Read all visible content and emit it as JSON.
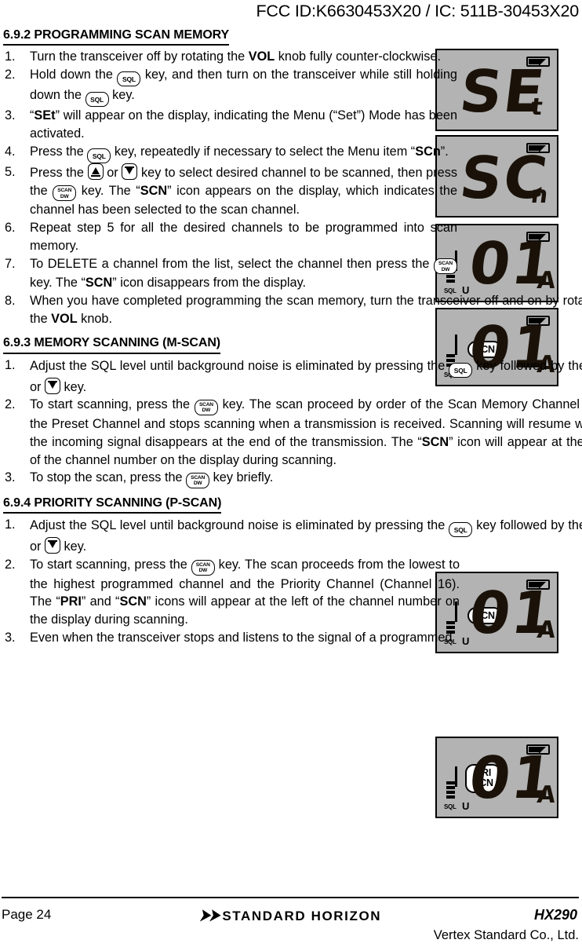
{
  "header": {
    "fcc_line": "FCC ID:K6630453X20 / IC: 511B-30453X20"
  },
  "sections": [
    {
      "id": "6.9.2",
      "number": "6.9.2",
      "title": "PROGRAMMING SCAN MEMORY",
      "heading_full": "6.9.2 PROGRAMMING SCAN MEMORY",
      "steps": [
        {
          "num": "1.",
          "text_parts": [
            "Turn the transceiver off by rotating the ",
            "VOL",
            " knob fully counter-clockwise."
          ]
        },
        {
          "num": "2.",
          "text_parts": [
            "Hold down the ",
            "SQL-KEY",
            " key, and then turn on the transceiver while still holding down the ",
            "SQL-KEY",
            " key."
          ]
        },
        {
          "num": "3.",
          "text_parts": [
            "“",
            "SEt",
            "” will appear on the display, indicating the Menu (“Set”) Mode has been activated."
          ]
        },
        {
          "num": "4.",
          "text_parts": [
            "Press the ",
            "SQL-KEY",
            " key, repeatedly if necessary to select the Menu item “",
            "SCn",
            "”."
          ]
        },
        {
          "num": "5.",
          "text_parts": [
            "Press the ",
            "UP-KEY",
            " or ",
            "DOWN-KEY",
            " key to select desired channel to be scanned, then press the ",
            "SCAN-KEY",
            " key. The “",
            "SCN",
            "” icon appears on the display, which indicates the channel has been selected to the scan channel."
          ]
        },
        {
          "num": "6.",
          "text_parts": [
            "Repeat step 5 for all the desired channels to be programmed into scan memory."
          ]
        },
        {
          "num": "7.",
          "text_parts": [
            "To DELETE a channel from the list, select the channel then press the ",
            "SCAN-KEY",
            " key. The “",
            "SCN",
            "” icon disappears from the display."
          ]
        },
        {
          "num": "8.",
          "text_parts": [
            "When you have completed programming the scan memory, turn the transceiver off and on by rotating the ",
            "VOL",
            " knob."
          ]
        }
      ]
    },
    {
      "id": "6.9.3",
      "number": "6.9.3",
      "title": "MEMORY SCANNING",
      "title_suffix": "(M-SCAN)",
      "heading_full": "6.9.3 MEMORY SCANNING (M-SCAN)",
      "steps": [
        {
          "num": "1.",
          "text_parts": [
            "Adjust the SQL level until background noise is eliminated by pressing the ",
            "SQL-KEY",
            " key followed by the ",
            "UP-KEY",
            " or ",
            "DOWN-KEY",
            " key."
          ]
        },
        {
          "num": "2.",
          "text_parts": [
            "To start scanning, press the ",
            "SCAN-KEY",
            " key. The scan proceed by order of the Scan Memory Channel and the Preset Channel and stops scanning when a transmission is received. Scanning will resume when the incoming signal disappears at the end of the transmission. The “",
            "SCN",
            "” icon will appear at the left of the channel number on the display during scanning."
          ]
        },
        {
          "num": "3.",
          "text_parts": [
            "To stop the scan, press the ",
            "SCAN-KEY",
            " key briefly."
          ]
        }
      ]
    },
    {
      "id": "6.9.4",
      "number": "6.9.4",
      "title": "PRIORITY SCANNING",
      "title_suffix": "(P-SCAN)",
      "heading_full": "6.9.4 PRIORITY SCANNING (P-SCAN)",
      "steps": [
        {
          "num": "1.",
          "text_parts": [
            "Adjust the SQL level until background noise is eliminated by pressing the ",
            "SQL-KEY",
            " key followed by the ",
            "UP-KEY",
            " or ",
            "DOWN-KEY",
            " key."
          ]
        },
        {
          "num": "2.",
          "text_parts": [
            "To start scanning, press the ",
            "SCAN-KEY",
            " key. The scan proceeds from the lowest to the highest programmed channel and the Priority Channel (Channel 16). The “",
            "PRI",
            "” and “",
            "SCN",
            "” icons will appear at the left of the channel number on the display during scanning."
          ]
        },
        {
          "num": "3.",
          "text_parts": [
            "Even when the transceiver stops and listens to the signal of a programmed"
          ]
        }
      ]
    }
  ],
  "body_text": {
    "s2_step1_a": "Turn the transceiver off by rotating the ",
    "s2_step1_vol": "VOL",
    "s2_step1_b": " knob fully counter-clockwise.",
    "s2_step2_a": "Hold down the ",
    "s2_step2_b": " key, and then turn on the transceiver while still holding down the ",
    "s2_step2_c": " key.",
    "s2_step3_a": "“",
    "s2_step3_set": "SEt",
    "s2_step3_b": "” will appear on the display, indicating the Menu (“Set”) Mode has been activated.",
    "s2_step4_a": "Press the ",
    "s2_step4_b": " key, repeatedly if necessary to select the Menu item “",
    "s2_step4_scn": "SCn",
    "s2_step4_c": "”.",
    "s2_step5_a": "Press the ",
    "s2_step5_b": " or ",
    "s2_step5_c": " key to select desired channel to be scanned, then press the ",
    "s2_step5_d": " key. The “",
    "s2_step5_scn": "SCN",
    "s2_step5_e": "” icon appears on the display, which indicates the channel has been selected to the scan channel.",
    "s2_step6": "Repeat step 5 for all the desired channels to be programmed into scan memory.",
    "s2_step7_a": "To DELETE a channel from the list, select the channel then press the ",
    "s2_step7_b": " key. The “",
    "s2_step7_scn": "SCN",
    "s2_step7_c": "” icon disappears from the display.",
    "s2_step8_a": "When you have completed programming the scan memory, turn the transceiver off and on by rotating the ",
    "s2_step8_vol": "VOL",
    "s2_step8_b": " knob.",
    "sql_step_a": "Adjust the SQL level until background noise is eliminated by pressing the ",
    "sql_step_b": " key followed by the ",
    "sql_step_c": " or ",
    "sql_step_d": " key.",
    "s3_step2_a": "To start scanning, press the ",
    "s3_step2_b": " key. The scan proceed by order of the Scan Memory Channel and the Preset Channel and stops scanning when a transmission is received. Scanning will resume when the incoming signal disappears at the end of the transmission. The “",
    "s3_step2_scn": "SCN",
    "s3_step2_c": "” icon will appear at the left of the channel number on the display during scanning.",
    "s3_step3_a": "To stop the scan, press the ",
    "s3_step3_b": " key briefly.",
    "s4_step2_a": "To start scanning, press the ",
    "s4_step2_b": " key. The scan proceeds from the lowest to the highest programmed channel and the Priority Channel (Channel 16). The “",
    "s4_step2_pri": "PRI",
    "s4_step2_mid": "” and “",
    "s4_step2_scn": "SCN",
    "s4_step2_c": "” icons will appear at the left of the channel number on the display during scanning.",
    "s4_step3": "Even when the transceiver stops and listens to the signal of a programmed"
  },
  "keys": {
    "sql": "SQL",
    "scan_line1": "SCAN",
    "scan_line2": "DW",
    "up": "▲",
    "down": "▼"
  },
  "lcd_displays": [
    {
      "id": "lcd-set",
      "main_text": "SE",
      "small_text": "t",
      "battery": true,
      "meter": false,
      "tags": []
    },
    {
      "id": "lcd-scn-menu",
      "main_text": "SC",
      "small_text": "n",
      "battery": true,
      "meter": false,
      "tags": []
    },
    {
      "id": "lcd-channel-01",
      "main_text": "01",
      "small_text": "A",
      "battery": true,
      "meter": true,
      "meter_label": "SQL",
      "meter_u": "U",
      "meter_bars": 3,
      "tags": []
    },
    {
      "id": "lcd-channel-01-scn",
      "main_text": "01",
      "small_text": "A",
      "battery": true,
      "meter": true,
      "meter_label": "SQL",
      "meter_u": "U",
      "meter_bars": 3,
      "tags": [
        "SCN"
      ]
    },
    {
      "id": "lcd-mscan",
      "main_text": "01",
      "small_text": "A",
      "battery": true,
      "meter": true,
      "meter_label": "SQL",
      "meter_u": "U",
      "meter_bars": 3,
      "tags": [
        "SCN"
      ]
    },
    {
      "id": "lcd-pscan",
      "main_text": "01",
      "small_text": "A",
      "battery": true,
      "meter": true,
      "meter_label": "SQL",
      "meter_u": "U",
      "meter_bars": 4,
      "tags": [
        "PRI",
        "SCN"
      ]
    }
  ],
  "footer": {
    "page_label": "Page 24",
    "brand": "STANDARD HORIZON",
    "brand_mark": "➤➤",
    "model": "HX290",
    "company": "Vertex Standard Co., Ltd."
  }
}
